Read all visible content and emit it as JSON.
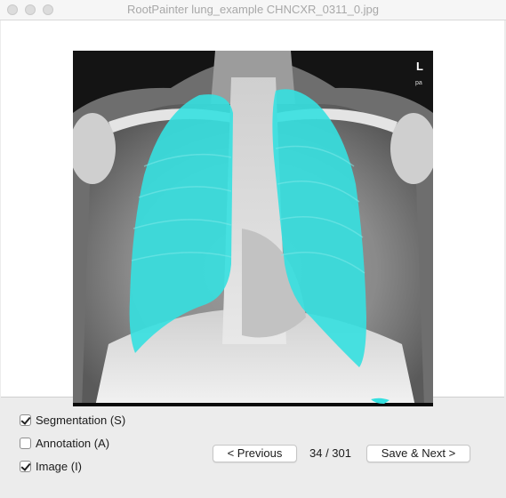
{
  "window": {
    "title": "RootPainter lung_example CHNCXR_0311_0.jpg"
  },
  "image": {
    "orientation_marker": "L",
    "projection_marker": "pa",
    "overlay_color": "#35e0e0"
  },
  "toggles": [
    {
      "label": "Segmentation (S)",
      "checked": true
    },
    {
      "label": "Annotation (A)",
      "checked": false
    },
    {
      "label": "Image (I)",
      "checked": true
    }
  ],
  "navigation": {
    "previous_label": "< Previous",
    "counter": "34 / 301",
    "next_label": "Save & Next >"
  }
}
